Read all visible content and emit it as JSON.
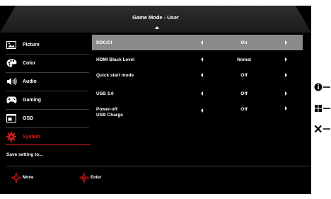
{
  "header": {
    "title": "Game Mode - User"
  },
  "sidebar": {
    "items": [
      {
        "label": "Picture",
        "icon": "picture-icon"
      },
      {
        "label": "Color",
        "icon": "color-palette-icon"
      },
      {
        "label": "Audio",
        "icon": "speaker-icon"
      },
      {
        "label": "Gaming",
        "icon": "gamepad-icon"
      },
      {
        "label": "OSD",
        "icon": "osd-window-icon"
      },
      {
        "label": "System",
        "icon": "gear-icon",
        "active": true
      }
    ],
    "save_label": "Save setting to..."
  },
  "settings": [
    {
      "label": "DDC/CI",
      "value": "On",
      "selected": true
    },
    {
      "label": "HDMI Black Level",
      "value": "Nomal"
    },
    {
      "label": "Quick start mode",
      "value": "Off"
    },
    {
      "label": "USB 3.0",
      "value": "Off"
    },
    {
      "label": "Power-off",
      "label2": "USB Charge",
      "value": "Off"
    }
  ],
  "footer": {
    "move_label": "Move",
    "enter_label": "Enter"
  },
  "colors": {
    "accent": "#e21c1c",
    "selected_row": "#8a8a8a",
    "background": "#000000"
  }
}
